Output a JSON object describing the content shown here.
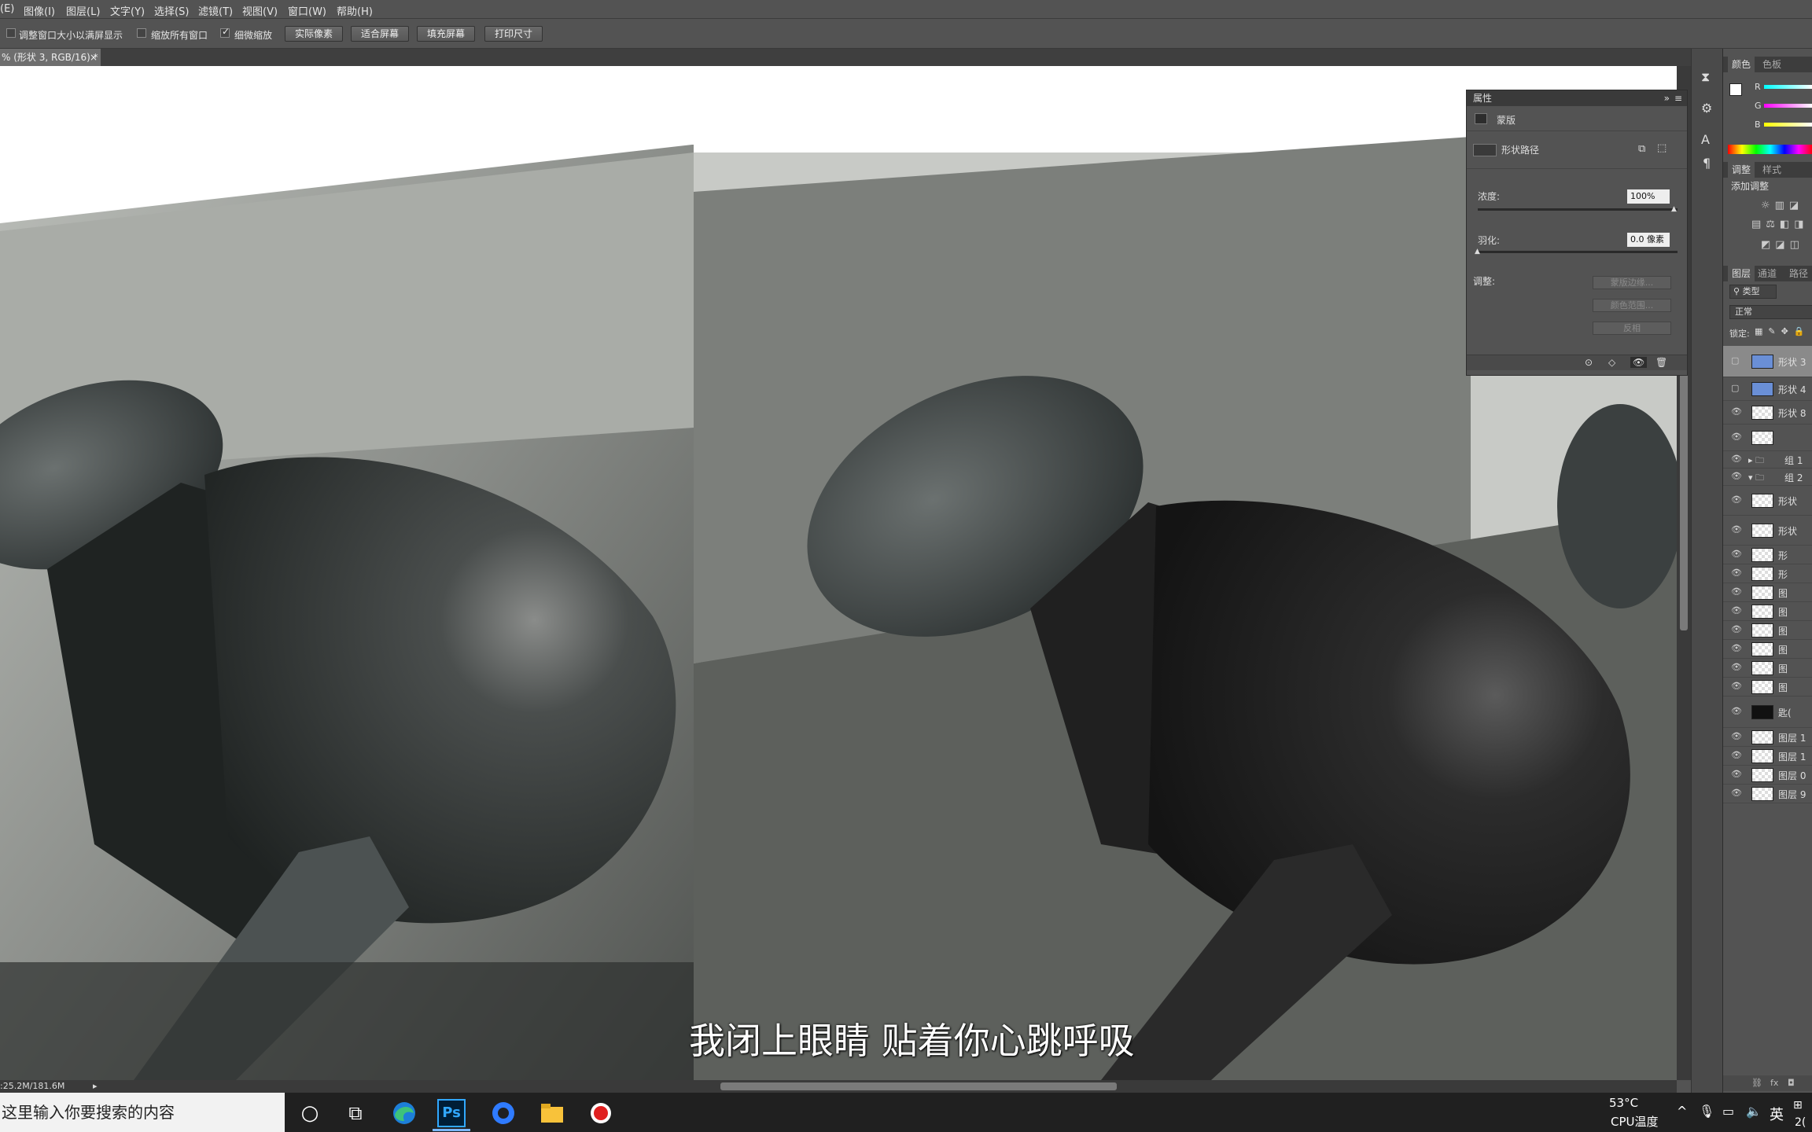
{
  "menu": [
    "(E)",
    "图像(I)",
    "图层(L)",
    "文字(Y)",
    "选择(S)",
    "滤镜(T)",
    "视图(V)",
    "窗口(W)",
    "帮助(H)"
  ],
  "options": {
    "resize_windows": "调整窗口大小以满屏显示",
    "zoom_all": "缩放所有窗口",
    "scrubby_zoom": "细微缩放",
    "actual_pixels": "实际像素",
    "fit_screen": "适合屏幕",
    "fill_screen": "填充屏幕",
    "print_size": "打印尺寸"
  },
  "document_tab": "% (形状 3, RGB/16) *",
  "status": ":25.2M/181.6M",
  "subtitle": "我闭上眼睛 贴着你心跳呼吸",
  "properties": {
    "title": "属性",
    "mask_type": "蒙版",
    "shape_path": "形状路径",
    "density_label": "浓度:",
    "density_value": "100%",
    "feather_label": "羽化:",
    "feather_value": "0.0 像素",
    "refine_label": "调整:",
    "mask_edge": "蒙版边缘...",
    "color_range": "颜色范围...",
    "invert": "反相"
  },
  "color_panel": {
    "tabs": [
      "颜色",
      "色板"
    ],
    "r": "R",
    "g": "G",
    "b": "B"
  },
  "adjust_panel": {
    "tabs": [
      "调整",
      "样式"
    ],
    "title": "添加调整"
  },
  "layers_panel": {
    "tabs": [
      "图层",
      "通道",
      "路径"
    ],
    "filter": "类型",
    "blend": "正常",
    "lock": "锁定:",
    "layers": [
      {
        "name": "形状 3",
        "visible": false,
        "selected": true
      },
      {
        "name": "形状 4",
        "visible": false
      },
      {
        "name": "形状 8",
        "visible": true
      },
      {
        "name": "",
        "visible": true
      },
      {
        "name": "组 1",
        "visible": true,
        "group": true
      },
      {
        "name": "组 2",
        "visible": true,
        "group": true
      },
      {
        "name": "形状",
        "visible": true
      },
      {
        "name": "形状",
        "visible": true
      },
      {
        "name": "形",
        "visible": true
      },
      {
        "name": "形",
        "visible": true
      },
      {
        "name": "图",
        "visible": true
      },
      {
        "name": "图",
        "visible": true
      },
      {
        "name": "图",
        "visible": true
      },
      {
        "name": "图",
        "visible": true
      },
      {
        "name": "图",
        "visible": true
      },
      {
        "name": "图",
        "visible": true
      },
      {
        "name": "匙(",
        "visible": true
      },
      {
        "name": "图层 1",
        "visible": true
      },
      {
        "name": "图层 1",
        "visible": true
      },
      {
        "name": "图层 0",
        "visible": true
      },
      {
        "name": "图层 9",
        "visible": true
      }
    ]
  },
  "taskbar": {
    "search_placeholder": "这里输入你要搜索的内容",
    "temp": "53°C",
    "temp_label": "CPU温度",
    "ime": "英",
    "clock": "2("
  }
}
